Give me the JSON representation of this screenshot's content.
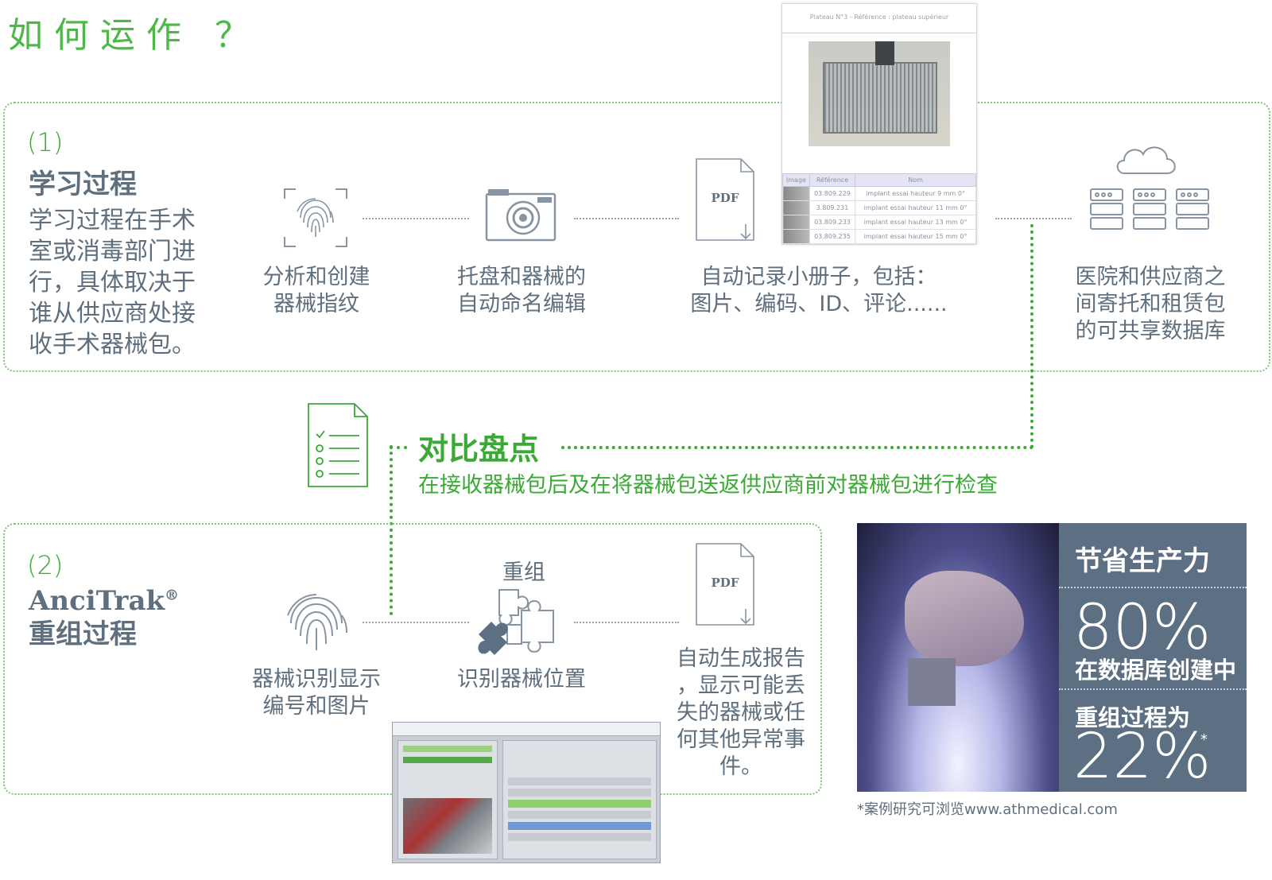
{
  "title": "如何运作 ？",
  "step1": {
    "number": "1",
    "title": "学习过程",
    "description_lines": [
      "学习过程在手术",
      "室或消毒部门进",
      "行，具体取决于",
      "谁从供应商处接",
      "收手术器械包。"
    ],
    "items": [
      {
        "lines": [
          "分析和创建",
          "器械指纹"
        ]
      },
      {
        "lines": [
          "托盘和器械的",
          "自动命名编辑"
        ]
      },
      {
        "lines": [
          "自动记录小册子，包括：",
          "图片、编码、ID、评论......"
        ]
      },
      {
        "lines": [
          "医院和供应商之",
          "间寄托和租赁包",
          "的可共享数据库"
        ]
      }
    ],
    "pdf_label": "PDF"
  },
  "booklet": {
    "header": "Plateau N°3 - Référence : plateau supérieur",
    "columns": [
      "Image",
      "Référence",
      "Nom"
    ],
    "rows": [
      [
        "",
        "03.809.229",
        "implant essai hauteur 9 mm 0°"
      ],
      [
        "",
        "3.809.231",
        "implant essai hauteur 11 mm 0°"
      ],
      [
        "",
        "03.809.233",
        "implant essai hauteur 13 mm 0°"
      ],
      [
        "",
        "03.809.235",
        "implant essai hauteur 15 mm 0°"
      ]
    ]
  },
  "compare": {
    "title": "对比盘点",
    "subtitle": "在接收器械包后及在将器械包送返供应商前对器械包进行检查"
  },
  "step2": {
    "number": "2",
    "brand": "AnciTrak",
    "brand_mark": "®",
    "title": "重组过程",
    "puzzle_label": "重组",
    "pdf_label": "PDF",
    "items": [
      {
        "lines": [
          "器械识别显示",
          "编号和图片"
        ]
      },
      {
        "lines": [
          "识别器械位置"
        ]
      },
      {
        "lines": [
          "自动生成报告",
          "，显示可能丢",
          "失的器械或任",
          "何其他异常事",
          "件。"
        ]
      }
    ]
  },
  "stats": {
    "heading": "节省生产力",
    "value1": "80%",
    "label1": "在数据库创建中",
    "label2": "重组过程为",
    "value2": "22%",
    "asterisk": "*",
    "footnote": "*案例研究可浏览www.athmedical.com"
  },
  "colors": {
    "accent_green": "#3aaa35",
    "stat_bg": "#5d6f82",
    "text_gray": "#5f6f7e"
  }
}
